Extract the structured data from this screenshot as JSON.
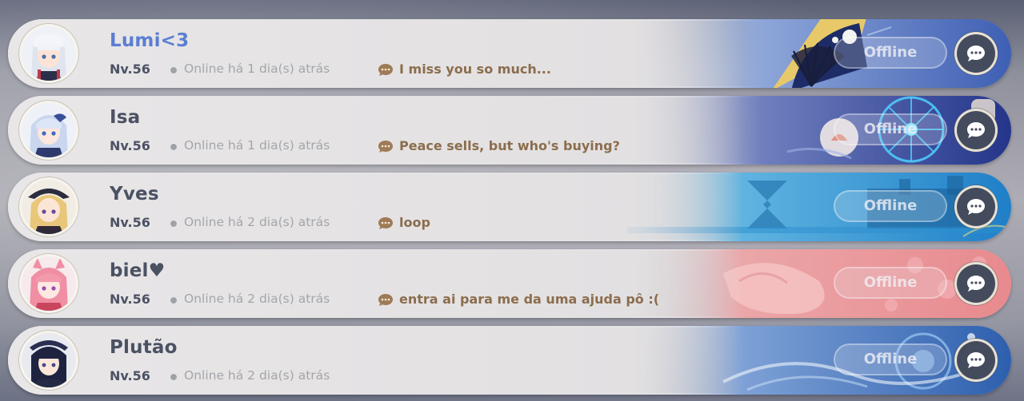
{
  "friends": [
    {
      "name": "Lumi<3",
      "level": "Nv.56",
      "last_online": "Online há 1 dia(s) atrás",
      "signature": "I miss you so much...",
      "status": "Offline",
      "name_color": "#5b7ed1",
      "card_theme": "blue-fan",
      "avatar": "white-hair-girl-avatar"
    },
    {
      "name": "Isa",
      "level": "Nv.56",
      "last_online": "Online há 1 dia(s) atrás",
      "signature": "Peace sells, but who's buying?",
      "status": "Offline",
      "name_color": "#4a5263",
      "card_theme": "night-blue-wheel",
      "avatar": "silver-blue-hair-girl-avatar"
    },
    {
      "name": "Yves",
      "level": "Nv.56",
      "last_online": "Online há 2 dia(s) atrás",
      "signature": "loop",
      "status": "Offline",
      "name_color": "#4a5263",
      "card_theme": "cyan-emblem",
      "avatar": "blonde-hat-girl-avatar"
    },
    {
      "name": "biel♥",
      "level": "Nv.56",
      "last_online": "Online há 2 dia(s) atrás",
      "signature": "entra ai para me da uma ajuda pô :(",
      "status": "Offline",
      "name_color": "#4a5263",
      "card_theme": "pink-fox",
      "avatar": "pink-hair-girl-avatar"
    },
    {
      "name": "Plutão",
      "level": "Nv.56",
      "last_online": "Online há 2 dia(s) atrás",
      "signature": "",
      "status": "Offline",
      "name_color": "#4a5263",
      "card_theme": "blue-wave",
      "avatar": "dark-hair-boy-avatar"
    }
  ]
}
